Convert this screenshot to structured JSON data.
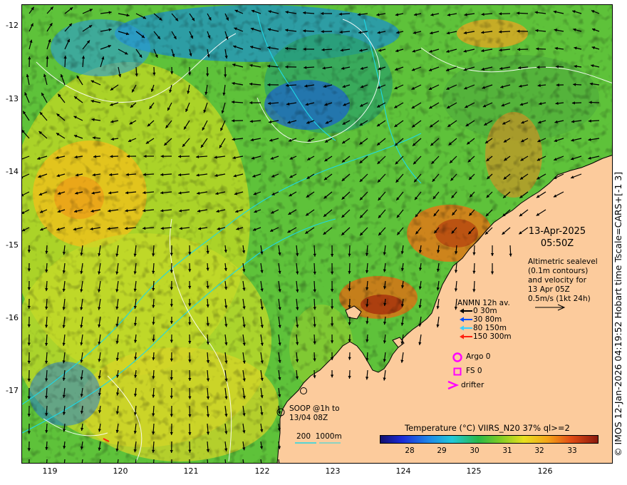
{
  "map": {
    "lat_ticks": [
      "-12",
      "-13",
      "-14",
      "-15",
      "-16",
      "-17"
    ],
    "lon_ticks": [
      "119",
      "120",
      "121",
      "122",
      "123",
      "124",
      "125",
      "126"
    ],
    "lat_range": [
      -17.97,
      -11.7
    ],
    "lon_range": [
      118.6,
      126.95
    ],
    "land_color": "#fccb9c",
    "colors": {
      "frame": "#000000",
      "arrow": "#000000",
      "sealevel_contour": "#ffffff",
      "isobath": "#1ed8e6",
      "argo_fs_drifter": "#ff00ff",
      "soop": "#000000"
    }
  },
  "datetime": {
    "date": "13-Apr-2025",
    "time": "05:50Z"
  },
  "altimetry": {
    "line1": "Altimetric sealevel",
    "line2": "(0.1m contours)",
    "line3": "and velocity for",
    "line4": "13 Apr 05Z",
    "line5": "0.5m/s (1kt 24h)"
  },
  "anmn": {
    "title": "ANMN 12h av.",
    "items": [
      {
        "label": "0 30m",
        "color": "#000000"
      },
      {
        "label": "30 80m",
        "color": "#0050ff"
      },
      {
        "label": "80 150m",
        "color": "#3ad0ff"
      },
      {
        "label": "150 300m",
        "color": "#ff2010"
      }
    ]
  },
  "legend": {
    "argo": "Argo 0",
    "fs": "FS 0",
    "drifter": "drifter"
  },
  "soop": {
    "line1": "SOOP @1h to",
    "line2": "13/04 08Z"
  },
  "isobath": {
    "shallow": "200",
    "deep": "1000m"
  },
  "colorbar": {
    "title": "Temperature (°C) VIIRS_N20 37% ql>=2",
    "ticks": [
      "28",
      "29",
      "30",
      "31",
      "32",
      "33"
    ],
    "range": [
      27.1,
      33.8
    ]
  },
  "credit": "© IMOS 12-Jan-2026 04:19:52 Hobart time Tscale=CARS+[-1 3]"
}
